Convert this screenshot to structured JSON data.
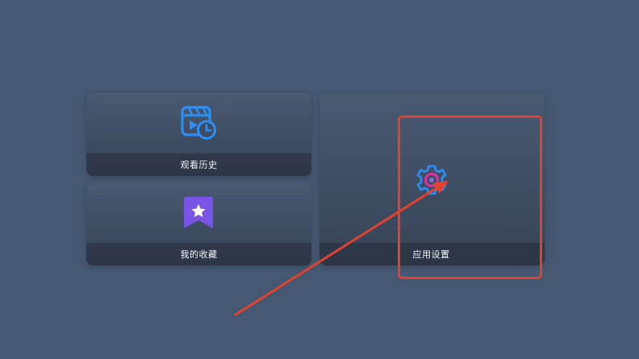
{
  "tiles": {
    "history": {
      "label": "观看历史",
      "icon": "video-history-icon"
    },
    "favorites": {
      "label": "我的收藏",
      "icon": "bookmark-star-icon"
    },
    "settings": {
      "label": "应用设置",
      "icon": "gear-icon"
    }
  },
  "colors": {
    "background": "#465771",
    "tile": "#3e4c62",
    "history_icon": "#2b8ff5",
    "favorites_icon": "#7a54e6",
    "settings_icon_outer": "#2e8cf0",
    "settings_icon_inner": "#e02ea0",
    "annotation": "#e1412f"
  }
}
